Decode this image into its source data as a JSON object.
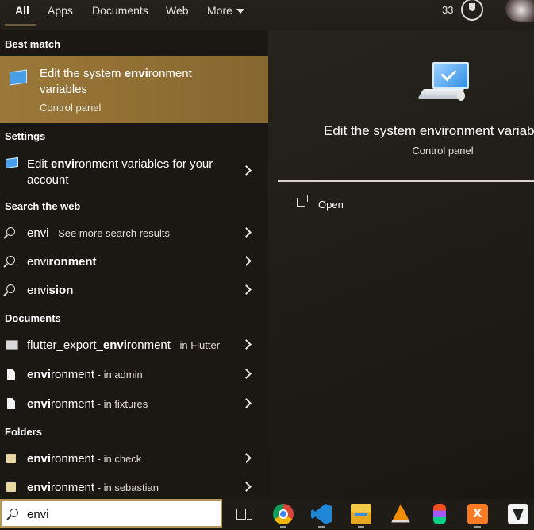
{
  "topbar": {
    "tabs": [
      "All",
      "Apps",
      "Documents",
      "Web",
      "More"
    ],
    "points": "33"
  },
  "left": {
    "best_match_heading": "Best match",
    "best_match": {
      "title_pre": "Edit the system ",
      "title_bold": "envi",
      "title_post": "ronment variables",
      "subtitle": "Control panel"
    },
    "settings_heading": "Settings",
    "settings_item": {
      "pre": "Edit ",
      "bold": "envi",
      "post": "ronment variables for your account"
    },
    "web_heading": "Search the web",
    "web_items": [
      {
        "pre": "envi",
        "bold": "",
        "sub": " - See more search results"
      },
      {
        "pre": "envi",
        "bold": "ronment",
        "sub": ""
      },
      {
        "pre": "envi",
        "bold": "sion",
        "sub": ""
      }
    ],
    "documents_heading": "Documents",
    "documents": [
      {
        "pre": "flutter_export_",
        "bold": "envi",
        "post": "ronment",
        "sub": " - in Flutter"
      },
      {
        "pre": "",
        "bold": "envi",
        "post": "ronment",
        "sub": " - in admin"
      },
      {
        "pre": "",
        "bold": "envi",
        "post": "ronment",
        "sub": " - in fixtures"
      }
    ],
    "folders_heading": "Folders",
    "folders": [
      {
        "pre": "",
        "bold": "envi",
        "post": "ronment",
        "sub": " - in check"
      },
      {
        "pre": "",
        "bold": "envi",
        "post": "ronment",
        "sub": " - in sebastian"
      }
    ]
  },
  "preview": {
    "title": "Edit the system environment variables",
    "subtitle": "Control panel",
    "open_label": "Open"
  },
  "search": {
    "value": "envi"
  }
}
